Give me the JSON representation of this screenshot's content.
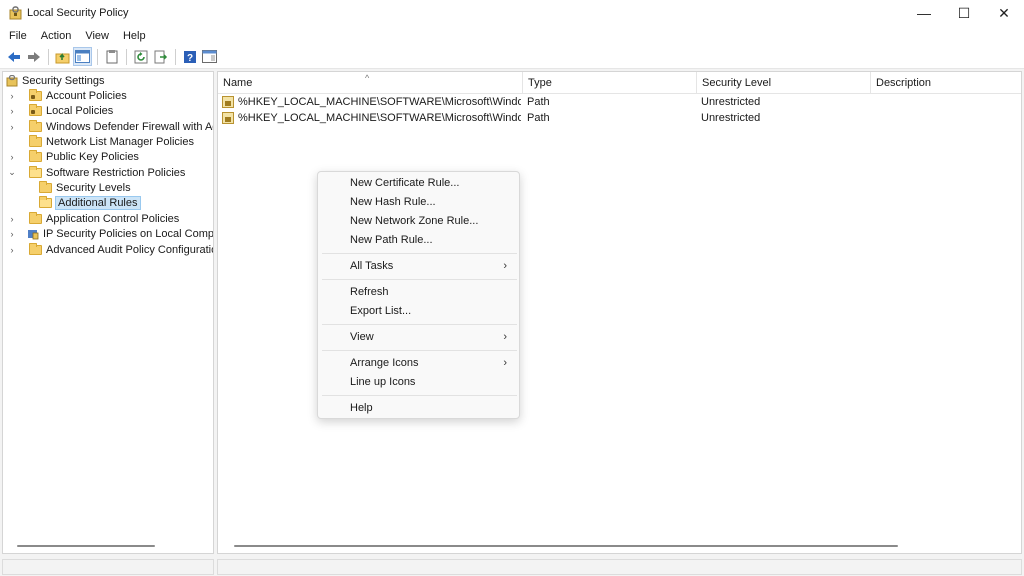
{
  "window": {
    "title": "Local Security Policy",
    "controls": {
      "minimize": "—",
      "maximize": "☐",
      "close": "✕"
    }
  },
  "menubar": [
    "File",
    "Action",
    "View",
    "Help"
  ],
  "toolbar": {
    "icons": [
      "back-arrow-icon",
      "forward-arrow-icon",
      "up-folder-icon",
      "show-hide-tree-icon",
      "properties-icon",
      "refresh-icon",
      "export-list-icon",
      "help-icon",
      "action-pane-icon"
    ]
  },
  "tree": {
    "root": "Security Settings",
    "items": [
      {
        "label": "Account Policies",
        "expander": "›",
        "icon": "lock-folder-icon"
      },
      {
        "label": "Local Policies",
        "expander": "›",
        "icon": "lock-folder-icon"
      },
      {
        "label": "Windows Defender Firewall with Advanced Security",
        "expander": "›",
        "icon": "folder-icon"
      },
      {
        "label": "Network List Manager Policies",
        "expander": "",
        "icon": "folder-icon"
      },
      {
        "label": "Public Key Policies",
        "expander": "›",
        "icon": "folder-icon"
      },
      {
        "label": "Software Restriction Policies",
        "expander": "⌄",
        "icon": "folder-open-icon"
      },
      {
        "label": "Security Levels",
        "expander": "",
        "icon": "folder-icon"
      },
      {
        "label": "Additional Rules",
        "expander": "",
        "icon": "folder-open-icon"
      },
      {
        "label": "Application Control Policies",
        "expander": "›",
        "icon": "folder-icon"
      },
      {
        "label": "IP Security Policies on Local Computer",
        "expander": "›",
        "icon": "shield-icon"
      },
      {
        "label": "Advanced Audit Policy Configuration",
        "expander": "›",
        "icon": "folder-icon"
      }
    ]
  },
  "list": {
    "columns": [
      "Name",
      "Type",
      "Security Level",
      "Description"
    ],
    "sort_indicator": "^",
    "rows": [
      {
        "name": "%HKEY_LOCAL_MACHINE\\SOFTWARE\\Microsoft\\Windows...",
        "type": "Path",
        "level": "Unrestricted",
        "description": ""
      },
      {
        "name": "%HKEY_LOCAL_MACHINE\\SOFTWARE\\Microsoft\\Windows...",
        "type": "Path",
        "level": "Unrestricted",
        "description": ""
      }
    ]
  },
  "context_menu": {
    "items": [
      "New Certificate Rule...",
      "New Hash Rule...",
      "New Network Zone Rule...",
      "New Path Rule...",
      "All Tasks",
      "Refresh",
      "Export List...",
      "View",
      "Arrange Icons",
      "Line up Icons",
      "Help"
    ],
    "submenu_arrow": "›"
  },
  "colors": {
    "selection": "#cce4f7",
    "folder": "#f5cf6b",
    "accent_blue": "#2b6cc4"
  }
}
